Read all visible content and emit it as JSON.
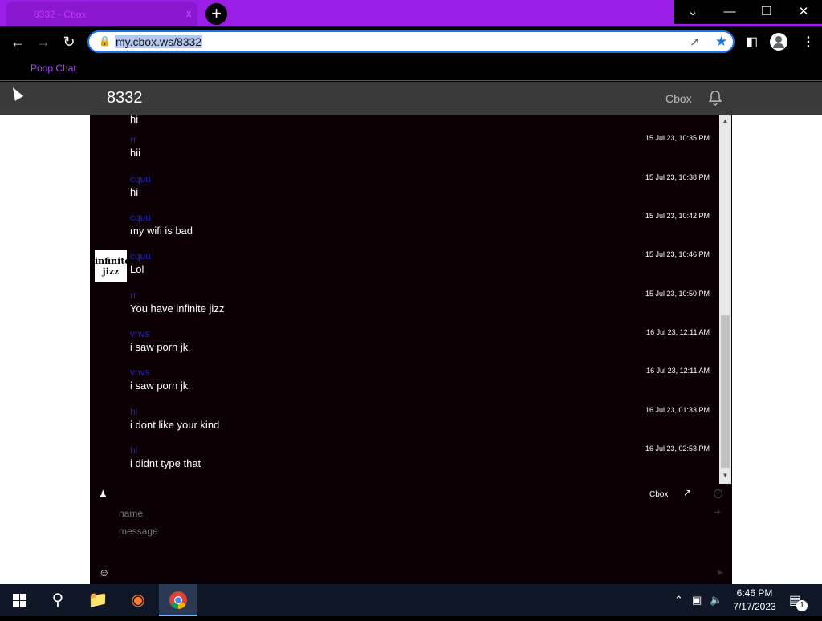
{
  "browser": {
    "tab_title": "8332 - Cbox",
    "tab_close": "x",
    "new_tab": "+",
    "url": "my.cbox.ws/8332",
    "bookmark": "Poop Chat"
  },
  "site": {
    "title": "8332",
    "cbox_link": "Cbox"
  },
  "messages": [
    {
      "name": "",
      "text": "hi",
      "time": ""
    },
    {
      "name": "rr",
      "text": "hii",
      "time": "15 Jul 23, 10:35 PM"
    },
    {
      "name": "cquu",
      "text": "hi",
      "time": "15 Jul 23, 10:38 PM"
    },
    {
      "name": "cquu",
      "text": "my wifi is bad",
      "time": "15 Jul 23, 10:42 PM"
    },
    {
      "name": "cquu",
      "text": "Lol",
      "time": "15 Jul 23, 10:46 PM",
      "avatar": "infinite jizz"
    },
    {
      "name": "rr",
      "text": "You have infinite jizz",
      "time": "15 Jul 23, 10:50 PM"
    },
    {
      "name": "vnvs",
      "text": "i saw porn jk",
      "time": "16 Jul 23, 12:11 AM"
    },
    {
      "name": "vnvs",
      "text": "i saw porn jk",
      "time": "16 Jul 23, 12:11 AM"
    },
    {
      "name": "hi",
      "text": "i dont like your kind",
      "time": "16 Jul 23, 01:33 PM"
    },
    {
      "name": "hi",
      "text": "i didnt type that",
      "time": "16 Jul 23, 02:53 PM"
    }
  ],
  "compose": {
    "cbox_label": "Cbox",
    "name_placeholder": "name",
    "message_placeholder": "message"
  },
  "taskbar": {
    "time": "6:46 PM",
    "date": "7/17/2023",
    "notification_count": "1"
  }
}
